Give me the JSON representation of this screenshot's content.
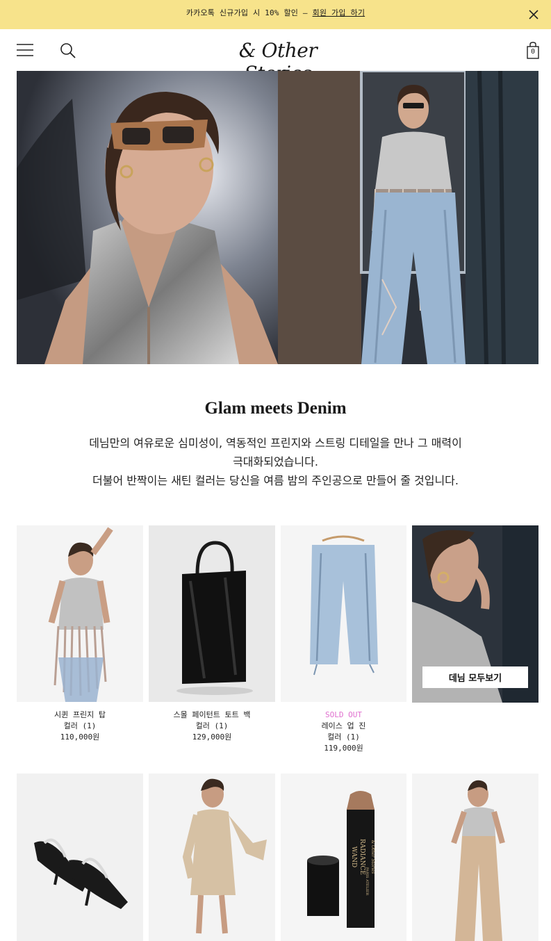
{
  "promo": {
    "text": "카카오톡 신규가입 시 10% 할인 – ",
    "link": "회원 가입 하기"
  },
  "header": {
    "logo": "& Other Stories",
    "bag_count": "0"
  },
  "feature": {
    "title": "Glam meets Denim",
    "lines": [
      "데님만의 여유로운 심미성이, 역동적인 프린지와 스트링 디테일을 만나 그 매력이",
      "극대화되었습니다.",
      "더불어 반짝이는 새틴 컬러는 당신을 여름 밤의 주인공으로 만들어 줄 것입니다."
    ]
  },
  "products": [
    {
      "name": "시퀸 프린지 탑",
      "color": "컬러 (1)",
      "price": "110,000원"
    },
    {
      "name": "스몰 페이턴트 토트 백",
      "color": "컬러 (1)",
      "price": "129,000원"
    },
    {
      "status": "SOLD OUT",
      "name": "레이스 업 진",
      "color": "컬러 (1)",
      "price": "119,000원"
    }
  ],
  "cta": {
    "view_all": "데님 모두보기"
  },
  "packaging": {
    "line1": "RADIANCE",
    "line2": "WAND",
    "line3": "PARIS ATELIER",
    "line4": "& Other Stories"
  },
  "colors": {
    "promo_bg": "#f7e38b",
    "sold_out": "#e06fcf"
  }
}
